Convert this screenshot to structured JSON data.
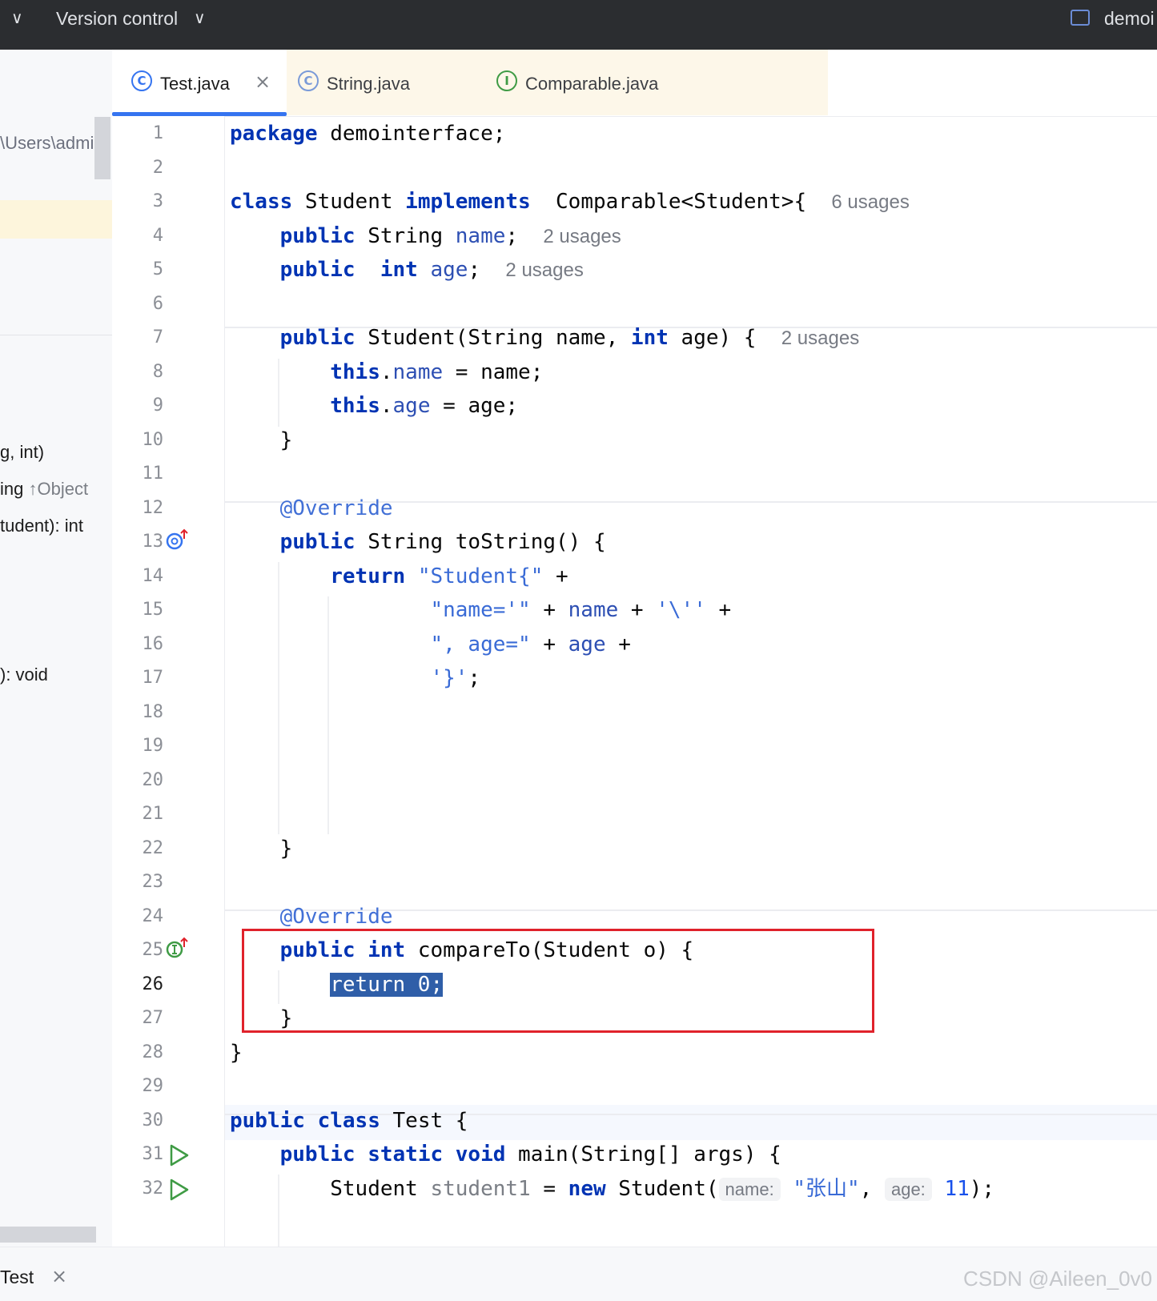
{
  "titlebar": {
    "menu_arrow": "∨",
    "version_control": "Version control",
    "vc_arrow": "∨",
    "project": "demoi"
  },
  "left_panel": {
    "path": "\\Users\\admin\\",
    "members": [
      {
        "text": "g, int)",
        "extra": ""
      },
      {
        "text": "ing ",
        "extra": "↑Object"
      },
      {
        "text": "tudent): int",
        "extra": ""
      },
      {
        "text": "): void",
        "extra": ""
      }
    ]
  },
  "tabs": [
    {
      "label": "Test.java",
      "icon": "C",
      "close": "×"
    },
    {
      "label": "String.java",
      "icon": "C"
    },
    {
      "label": "Comparable.java",
      "icon": "I"
    }
  ],
  "line_numbers": [
    "1",
    "2",
    "3",
    "4",
    "5",
    "6",
    "7",
    "8",
    "9",
    "10",
    "11",
    "12",
    "13",
    "14",
    "15",
    "16",
    "17",
    "18",
    "19",
    "20",
    "21",
    "22",
    "23",
    "24",
    "25",
    "26",
    "27",
    "28",
    "29",
    "30",
    "31",
    "32"
  ],
  "current_line": "26",
  "code": {
    "l1": [
      "package",
      " demointerface;"
    ],
    "l3": [
      "class",
      " Student ",
      "implements",
      "  Comparable<Student>{",
      "6 usages"
    ],
    "l4": [
      "    ",
      "public",
      " String ",
      "name",
      ";",
      "2 usages"
    ],
    "l5": [
      "    ",
      "public",
      "  ",
      "int",
      " ",
      "age",
      ";",
      "2 usages"
    ],
    "l7": [
      "    ",
      "public",
      " Student(String name, ",
      "int",
      " age) {",
      "2 usages"
    ],
    "l8": [
      "        ",
      "this",
      ".",
      "name",
      " = name;"
    ],
    "l9": [
      "        ",
      "this",
      ".",
      "age",
      " = age;"
    ],
    "l10": [
      "    }"
    ],
    "l12": [
      "    ",
      "@Override"
    ],
    "l13": [
      "    ",
      "public",
      " String toString() {"
    ],
    "l14": [
      "        ",
      "return",
      " ",
      "\"Student{\"",
      " +"
    ],
    "l15": [
      "                ",
      "\"name='\"",
      " + ",
      "name",
      " + ",
      "'\\''",
      " +"
    ],
    "l16": [
      "                ",
      "\", age=\"",
      " + ",
      "age",
      " +"
    ],
    "l17": [
      "                ",
      "'}'",
      ";"
    ],
    "l22": [
      "    }"
    ],
    "l24": [
      "    ",
      "@Override"
    ],
    "l25": [
      "    ",
      "public",
      " ",
      "int",
      " compareTo(Student o) {"
    ],
    "l26": [
      "        ",
      "return",
      " 0;"
    ],
    "l27": [
      "    }"
    ],
    "l28": [
      "}"
    ],
    "l30": [
      "public",
      " ",
      "class",
      " Test {"
    ],
    "l31": [
      "    ",
      "public",
      " ",
      "static",
      " ",
      "void",
      " main(String[] args) {"
    ],
    "l32": [
      "        ",
      "Student ",
      "student1",
      " = ",
      "new",
      " Student(",
      "name:",
      "\"张山\"",
      ", ",
      "age:",
      "11",
      ");"
    ]
  },
  "bottombar": {
    "run_label": "Test",
    "close": "×",
    "watermark": "CSDN @Aileen_0v0"
  },
  "colors": {
    "keyword": "#0033b3",
    "annotation": "#4270d6",
    "string": "#3a6bd6",
    "highlight_box": "#e0222b",
    "tab_active": "#3574f0"
  },
  "icons": [
    "override-up-icon",
    "implement-up-icon",
    "run-icon",
    "class-icon",
    "interface-icon",
    "close-icon"
  ]
}
